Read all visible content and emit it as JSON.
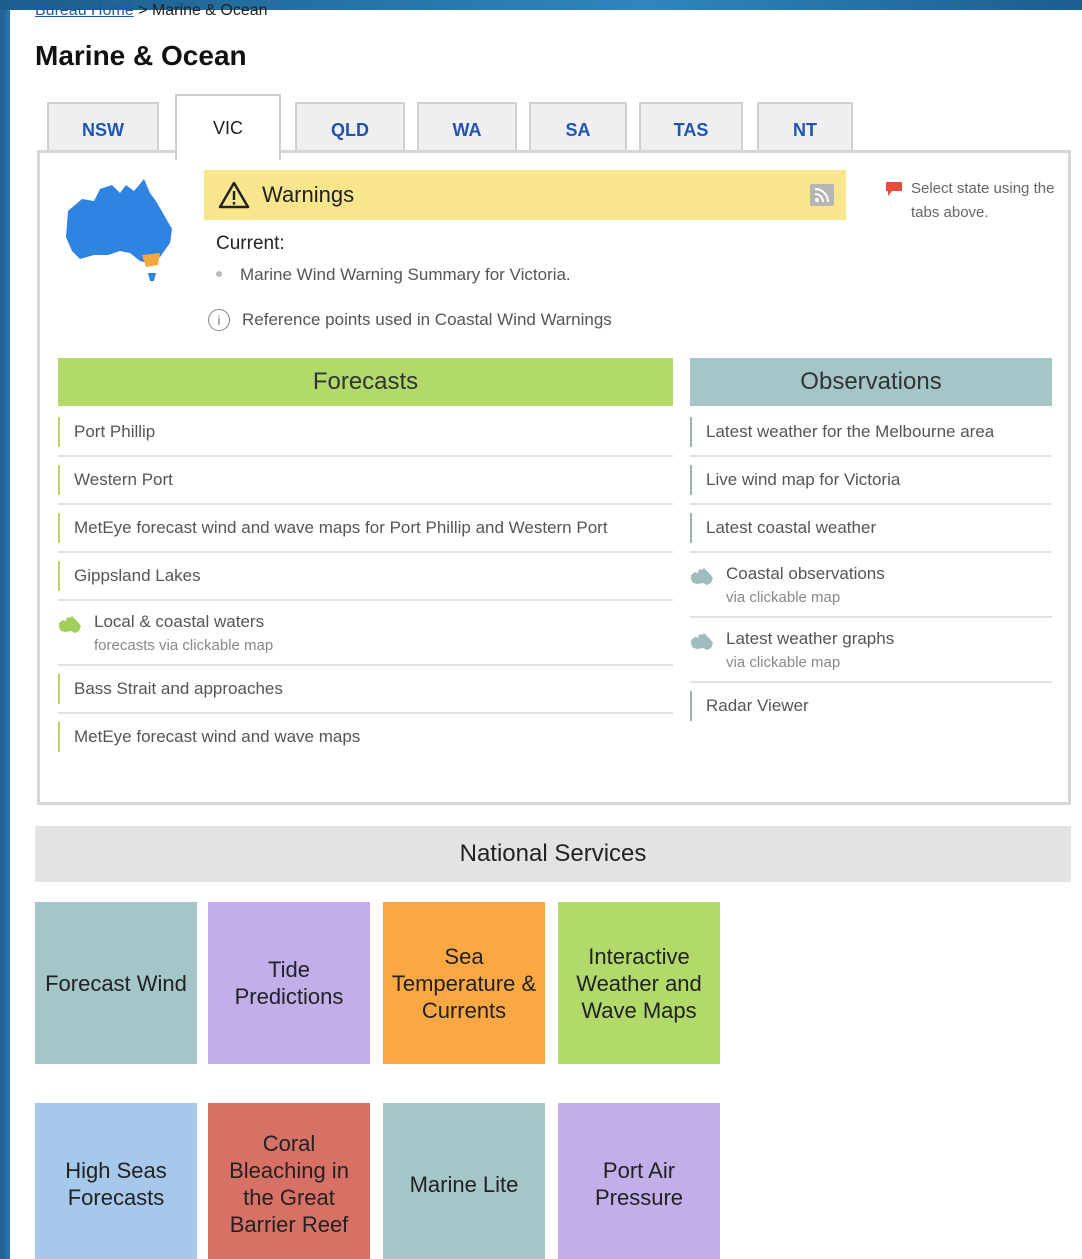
{
  "breadcrumb": {
    "home": "Bureau Home",
    "separator": " > ",
    "current": "Marine & Ocean"
  },
  "page_title": "Marine & Ocean",
  "tabs": [
    {
      "label": "NSW"
    },
    {
      "label": "VIC"
    },
    {
      "label": "QLD"
    },
    {
      "label": "WA"
    },
    {
      "label": "SA"
    },
    {
      "label": "TAS"
    },
    {
      "label": "NT"
    }
  ],
  "warnings": {
    "label": "Warnings",
    "current_label": "Current:",
    "current_item": "Marine Wind Warning Summary for Victoria.",
    "reference": "Reference points used in Coastal Wind Warnings"
  },
  "state_note": "Select state using the tabs above.",
  "forecasts": {
    "heading": "Forecasts",
    "items": [
      {
        "text": "Port Phillip"
      },
      {
        "text": "Western Port"
      },
      {
        "text": "MetEye forecast wind and wave maps for Port Phillip and Western Port"
      },
      {
        "text": "Gippsland Lakes"
      },
      {
        "text": "Local & coastal waters",
        "sub": "forecasts via clickable map"
      },
      {
        "text": "Bass Strait and approaches"
      },
      {
        "text": "MetEye forecast wind and wave maps"
      }
    ]
  },
  "observations": {
    "heading": "Observations",
    "items": [
      {
        "text": "Latest weather for the Melbourne area"
      },
      {
        "text": "Live wind map for Victoria"
      },
      {
        "text": "Latest coastal weather"
      },
      {
        "text": "Coastal observations",
        "sub": "via clickable map"
      },
      {
        "text": "Latest weather graphs",
        "sub": "via clickable map"
      },
      {
        "text": "Radar Viewer"
      }
    ]
  },
  "national_services": {
    "heading": "National Services",
    "tiles": [
      {
        "label": "Forecast Wind",
        "color": "#a4c6c9"
      },
      {
        "label": "Tide Predictions",
        "color": "#c2aee8"
      },
      {
        "label": "Sea Temperature & Currents",
        "color": "#fba844"
      },
      {
        "label": "Interactive Weather and Wave Maps",
        "color": "#b2da6b"
      },
      {
        "label": "High Seas Forecasts",
        "color": "#a6c8ea"
      },
      {
        "label": "Coral Bleaching in the Great Barrier Reef",
        "color": "#d77165"
      },
      {
        "label": "Marine Lite",
        "color": "#a4c6c9"
      },
      {
        "label": "Port Air Pressure",
        "color": "#c2aee8"
      }
    ]
  },
  "colors": {
    "warning_bar": "#f7e68b",
    "forecast_green": "#b2da6b",
    "observation_teal": "#a4c6c9",
    "australia_blue": "#2e84e0",
    "victoria_orange": "#f4a640",
    "flag_red": "#e74c3c"
  },
  "icons": {
    "warning": "warning-triangle-icon",
    "rss": "rss-icon",
    "info": "info-icon",
    "map": "australia-map-icon",
    "flag": "red-flag-icon"
  }
}
